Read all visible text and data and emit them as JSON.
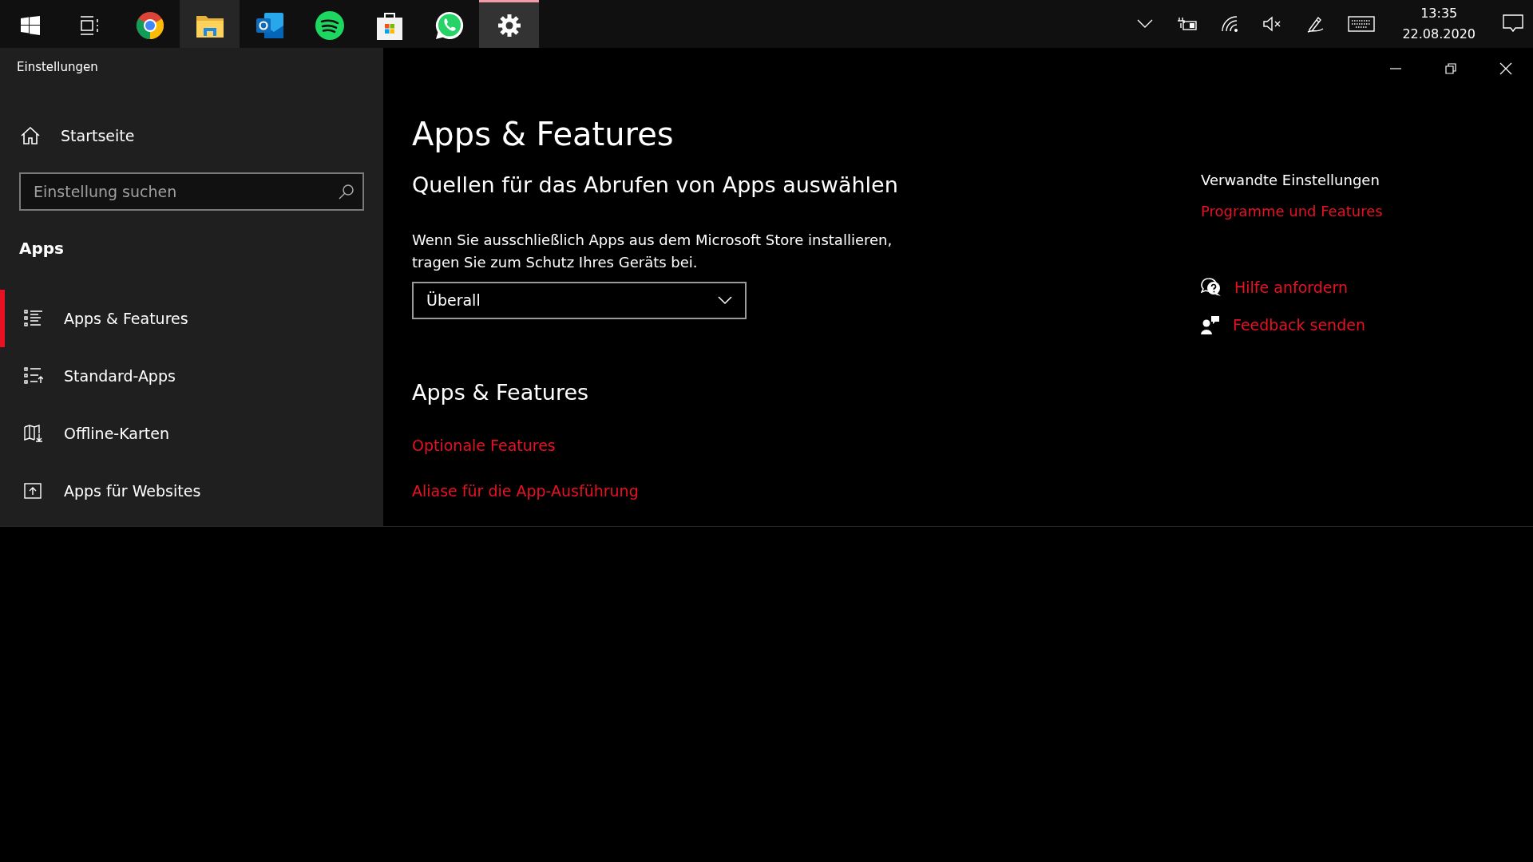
{
  "taskbar": {
    "apps": [
      {
        "kind": "start",
        "selected": false,
        "hovered": false
      },
      {
        "kind": "taskview",
        "selected": false,
        "hovered": false
      },
      {
        "kind": "chrome",
        "selected": false,
        "hovered": false
      },
      {
        "kind": "explorer",
        "selected": false,
        "hovered": true
      },
      {
        "kind": "outlook",
        "selected": false,
        "hovered": false
      },
      {
        "kind": "spotify",
        "selected": false,
        "hovered": false
      },
      {
        "kind": "store",
        "selected": false,
        "hovered": false
      },
      {
        "kind": "whatsapp",
        "selected": false,
        "hovered": false
      },
      {
        "kind": "settings",
        "selected": true,
        "hovered": false
      }
    ],
    "tray": [
      {
        "kind": "chevron"
      },
      {
        "kind": "battery"
      },
      {
        "kind": "wifi"
      },
      {
        "kind": "volume-muted"
      },
      {
        "kind": "pen"
      },
      {
        "kind": "keyboard"
      }
    ],
    "time": "13:35",
    "date": "22.08.2020"
  },
  "window": {
    "title": "Einstellungen"
  },
  "sidebar": {
    "home": "Startseite",
    "search": {
      "placeholder": "Einstellung suchen"
    },
    "section": "Apps",
    "items": [
      {
        "label": "Apps & Features",
        "kind": "list",
        "selected": true
      },
      {
        "label": "Standard-Apps",
        "kind": "list-up",
        "selected": false
      },
      {
        "label": "Offline-Karten",
        "kind": "map",
        "selected": false
      },
      {
        "label": "Apps für Websites",
        "kind": "web",
        "selected": false
      }
    ]
  },
  "main": {
    "title": "Apps & Features",
    "subtitle": "Quellen für das Abrufen von Apps auswählen",
    "description": "Wenn Sie ausschließlich Apps aus dem Microsoft Store installieren, tragen Sie zum Schutz Ihres Geräts bei.",
    "dropdown": {
      "value": "Überall"
    },
    "section": "Apps & Features",
    "links": [
      "Optionale Features",
      "Aliase für die App-Ausführung"
    ]
  },
  "related": {
    "title": "Verwandte Einstellungen",
    "links": [
      "Programme und Features"
    ],
    "help": [
      {
        "kind": "help",
        "label": "Hilfe anfordern"
      },
      {
        "kind": "feedback",
        "label": "Feedback senden"
      }
    ]
  }
}
